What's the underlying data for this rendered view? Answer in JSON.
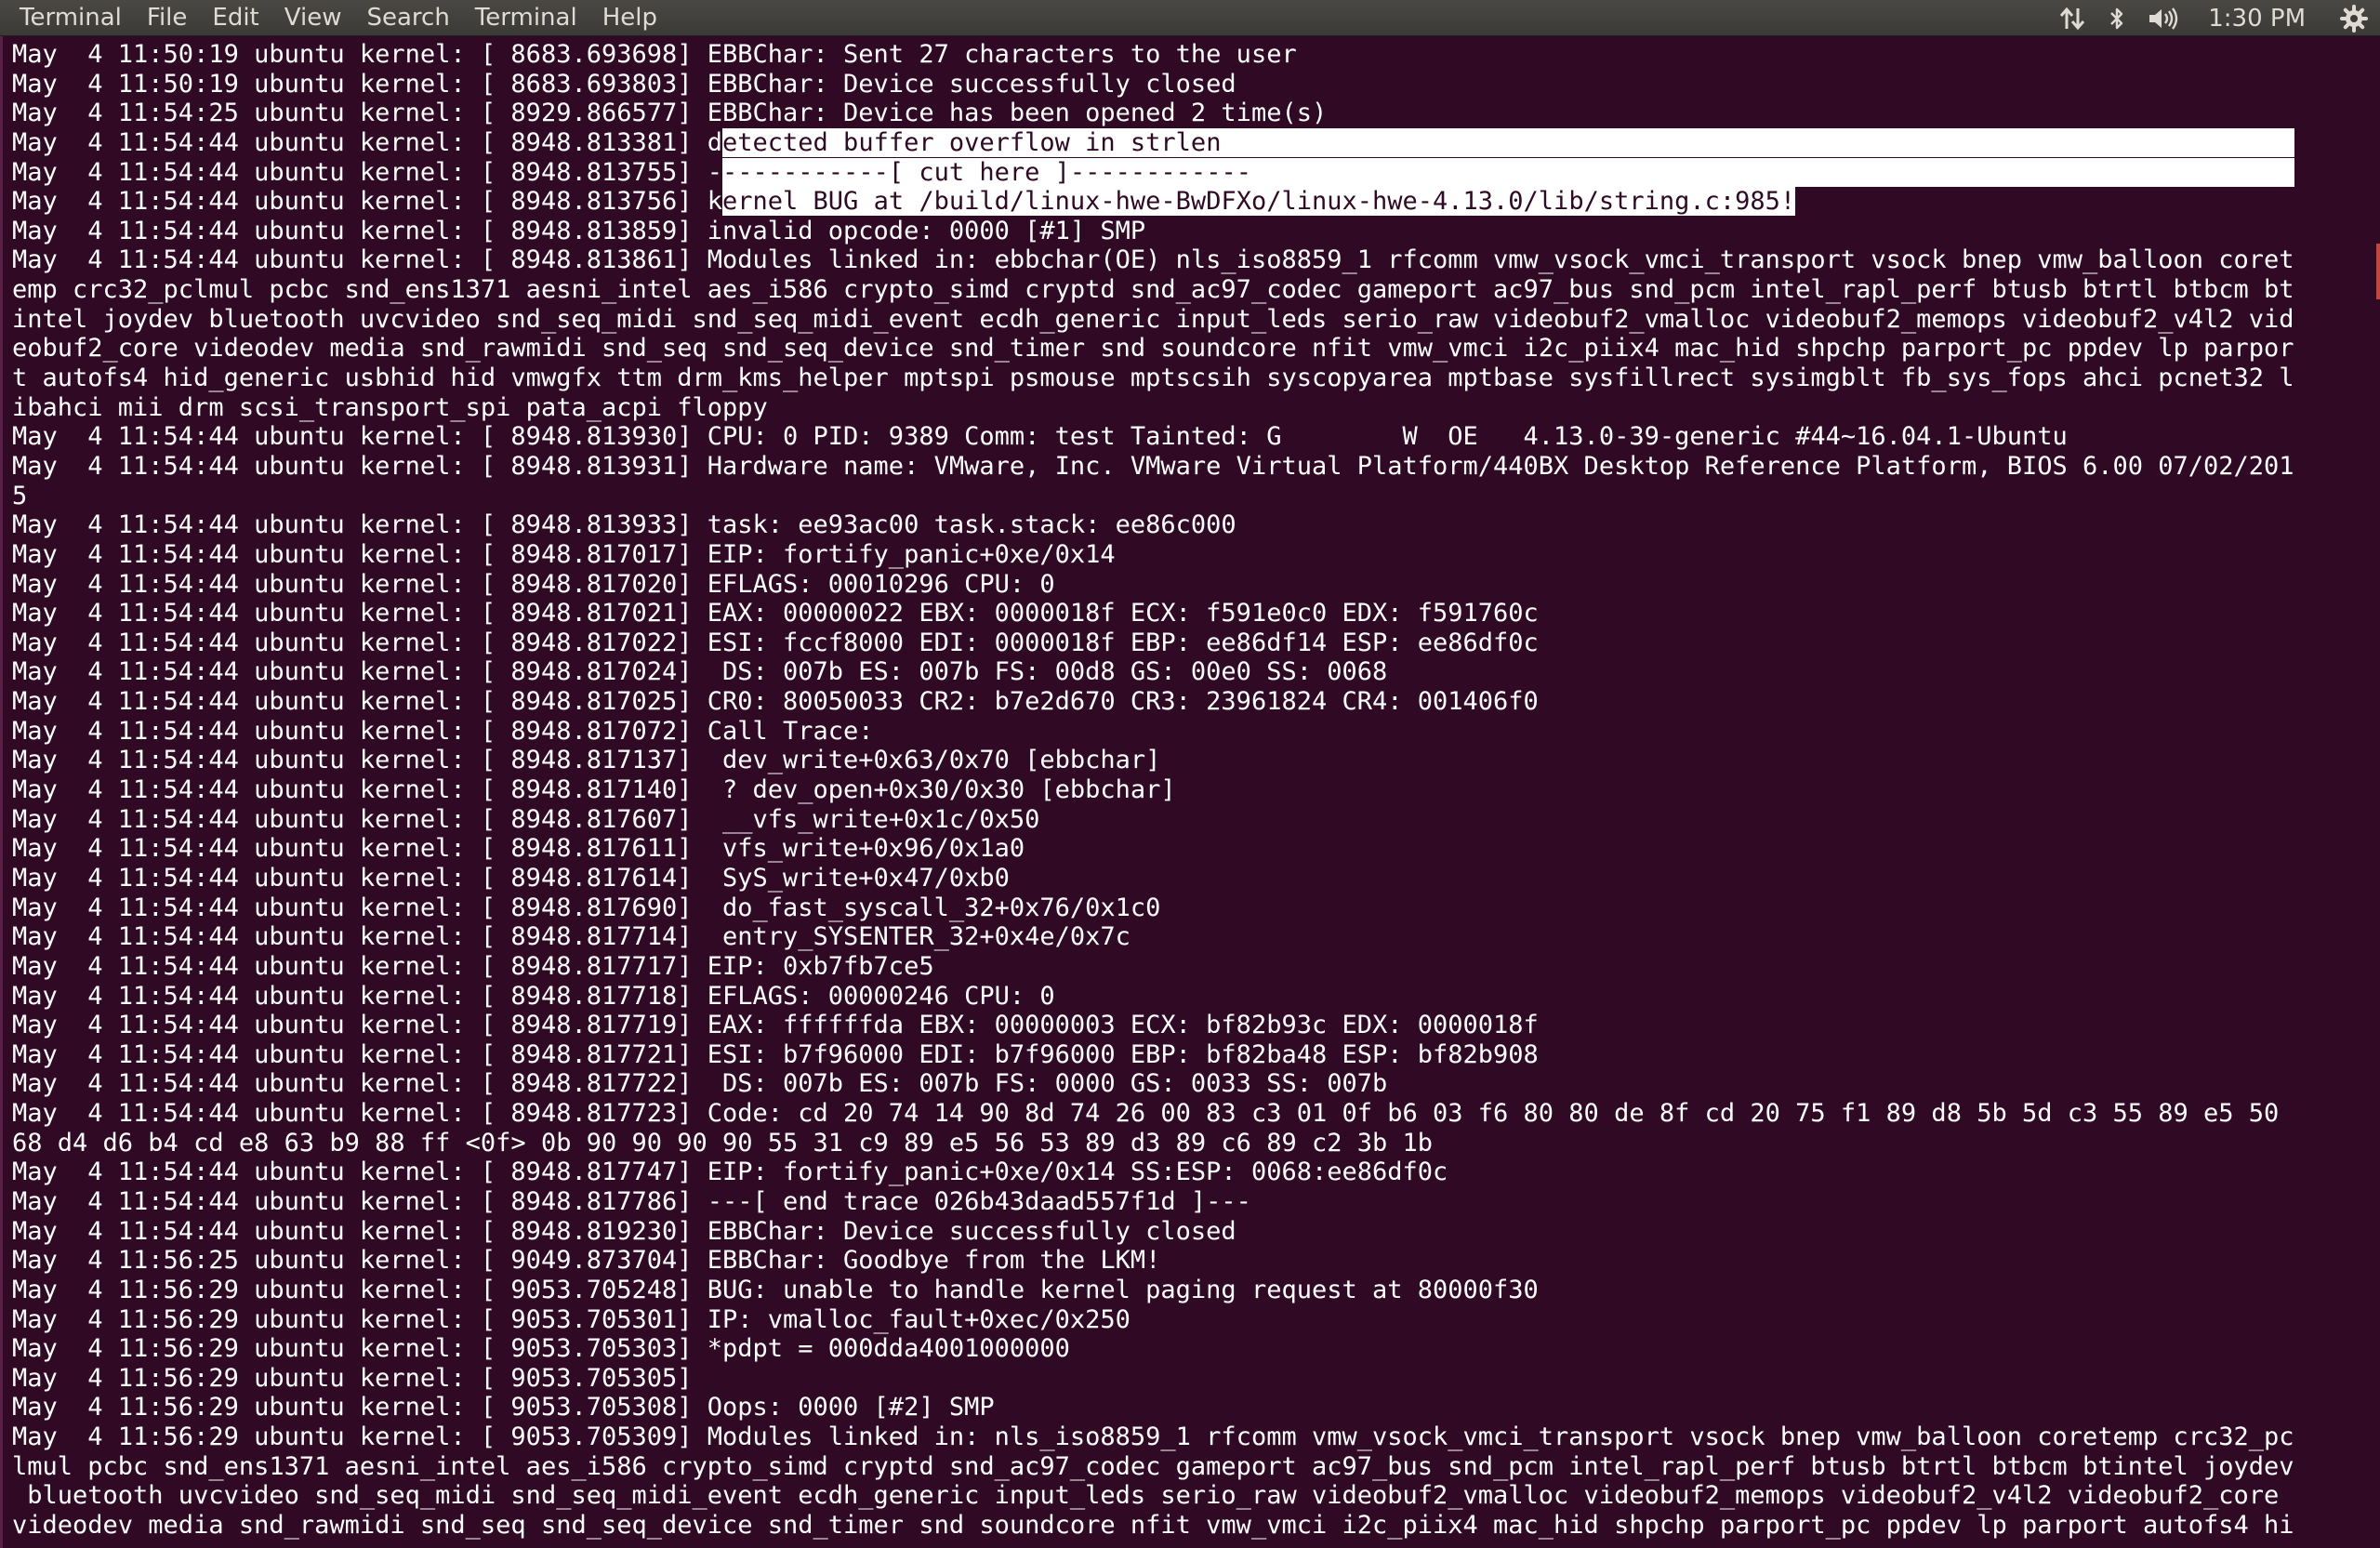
{
  "menubar": {
    "items": [
      "Terminal",
      "File",
      "Edit",
      "View",
      "Search",
      "Terminal",
      "Help"
    ],
    "indicators": {
      "network_icon": "network-updown-icon",
      "bluetooth_icon": "bluetooth-icon",
      "sound_icon": "volume-icon",
      "clock": "1:30 PM",
      "settings_icon": "gear-icon"
    }
  },
  "colors": {
    "terminal_bg": "#300a24",
    "terminal_fg": "#ffffff",
    "menubar_bg": "#3c3b37",
    "menubar_fg": "#dfdbd2",
    "selection_bg": "#ffffff"
  },
  "terminal": {
    "lines": [
      "May  4 11:50:19 ubuntu kernel: [ 8683.693698] EBBChar: Sent 27 characters to the user",
      "May  4 11:50:19 ubuntu kernel: [ 8683.693803] EBBChar: Device successfully closed",
      "May  4 11:54:25 ubuntu kernel: [ 8929.866577] EBBChar: Device has been opened 2 time(s)",
      "May  4 11:54:44 ubuntu kernel: [ 8948.813381] detected buffer overflow in strlen",
      "May  4 11:54:44 ubuntu kernel: [ 8948.813755] ------------[ cut here ]------------",
      "May  4 11:54:44 ubuntu kernel: [ 8948.813756] kernel BUG at /build/linux-hwe-BwDFXo/linux-hwe-4.13.0/lib/string.c:985!",
      "May  4 11:54:44 ubuntu kernel: [ 8948.813859] invalid opcode: 0000 [#1] SMP",
      "May  4 11:54:44 ubuntu kernel: [ 8948.813861] Modules linked in: ebbchar(OE) nls_iso8859_1 rfcomm vmw_vsock_vmci_transport vsock bnep vmw_balloon coret",
      "emp crc32_pclmul pcbc snd_ens1371 aesni_intel aes_i586 crypto_simd cryptd snd_ac97_codec gameport ac97_bus snd_pcm intel_rapl_perf btusb btrtl btbcm bt",
      "intel joydev bluetooth uvcvideo snd_seq_midi snd_seq_midi_event ecdh_generic input_leds serio_raw videobuf2_vmalloc videobuf2_memops videobuf2_v4l2 vid",
      "eobuf2_core videodev media snd_rawmidi snd_seq snd_seq_device snd_timer snd soundcore nfit vmw_vmci i2c_piix4 mac_hid shpchp parport_pc ppdev lp parpor",
      "t autofs4 hid_generic usbhid hid vmwgfx ttm drm_kms_helper mptspi psmouse mptscsih syscopyarea mptbase sysfillrect sysimgblt fb_sys_fops ahci pcnet32 l",
      "ibahci mii drm scsi_transport_spi pata_acpi floppy",
      "May  4 11:54:44 ubuntu kernel: [ 8948.813930] CPU: 0 PID: 9389 Comm: test Tainted: G        W  OE   4.13.0-39-generic #44~16.04.1-Ubuntu",
      "May  4 11:54:44 ubuntu kernel: [ 8948.813931] Hardware name: VMware, Inc. VMware Virtual Platform/440BX Desktop Reference Platform, BIOS 6.00 07/02/201",
      "5",
      "May  4 11:54:44 ubuntu kernel: [ 8948.813933] task: ee93ac00 task.stack: ee86c000",
      "May  4 11:54:44 ubuntu kernel: [ 8948.817017] EIP: fortify_panic+0xe/0x14",
      "May  4 11:54:44 ubuntu kernel: [ 8948.817020] EFLAGS: 00010296 CPU: 0",
      "May  4 11:54:44 ubuntu kernel: [ 8948.817021] EAX: 00000022 EBX: 0000018f ECX: f591e0c0 EDX: f591760c",
      "May  4 11:54:44 ubuntu kernel: [ 8948.817022] ESI: fccf8000 EDI: 0000018f EBP: ee86df14 ESP: ee86df0c",
      "May  4 11:54:44 ubuntu kernel: [ 8948.817024]  DS: 007b ES: 007b FS: 00d8 GS: 00e0 SS: 0068",
      "May  4 11:54:44 ubuntu kernel: [ 8948.817025] CR0: 80050033 CR2: b7e2d670 CR3: 23961824 CR4: 001406f0",
      "May  4 11:54:44 ubuntu kernel: [ 8948.817072] Call Trace:",
      "May  4 11:54:44 ubuntu kernel: [ 8948.817137]  dev_write+0x63/0x70 [ebbchar]",
      "May  4 11:54:44 ubuntu kernel: [ 8948.817140]  ? dev_open+0x30/0x30 [ebbchar]",
      "May  4 11:54:44 ubuntu kernel: [ 8948.817607]  __vfs_write+0x1c/0x50",
      "May  4 11:54:44 ubuntu kernel: [ 8948.817611]  vfs_write+0x96/0x1a0",
      "May  4 11:54:44 ubuntu kernel: [ 8948.817614]  SyS_write+0x47/0xb0",
      "May  4 11:54:44 ubuntu kernel: [ 8948.817690]  do_fast_syscall_32+0x76/0x1c0",
      "May  4 11:54:44 ubuntu kernel: [ 8948.817714]  entry_SYSENTER_32+0x4e/0x7c",
      "May  4 11:54:44 ubuntu kernel: [ 8948.817717] EIP: 0xb7fb7ce5",
      "May  4 11:54:44 ubuntu kernel: [ 8948.817718] EFLAGS: 00000246 CPU: 0",
      "May  4 11:54:44 ubuntu kernel: [ 8948.817719] EAX: ffffffda EBX: 00000003 ECX: bf82b93c EDX: 0000018f",
      "May  4 11:54:44 ubuntu kernel: [ 8948.817721] ESI: b7f96000 EDI: b7f96000 EBP: bf82ba48 ESP: bf82b908",
      "May  4 11:54:44 ubuntu kernel: [ 8948.817722]  DS: 007b ES: 007b FS: 0000 GS: 0033 SS: 007b",
      "May  4 11:54:44 ubuntu kernel: [ 8948.817723] Code: cd 20 74 14 90 8d 74 26 00 83 c3 01 0f b6 03 f6 80 80 de 8f cd 20 75 f1 89 d8 5b 5d c3 55 89 e5 50",
      "68 d4 d6 b4 cd e8 63 b9 88 ff <0f> 0b 90 90 90 90 55 31 c9 89 e5 56 53 89 d3 89 c6 89 c2 3b 1b",
      "May  4 11:54:44 ubuntu kernel: [ 8948.817747] EIP: fortify_panic+0xe/0x14 SS:ESP: 0068:ee86df0c",
      "May  4 11:54:44 ubuntu kernel: [ 8948.817786] ---[ end trace 026b43daad557f1d ]---",
      "May  4 11:54:44 ubuntu kernel: [ 8948.819230] EBBChar: Device successfully closed",
      "May  4 11:56:25 ubuntu kernel: [ 9049.873704] EBBChar: Goodbye from the LKM!",
      "May  4 11:56:29 ubuntu kernel: [ 9053.705248] BUG: unable to handle kernel paging request at 80000f30",
      "May  4 11:56:29 ubuntu kernel: [ 9053.705301] IP: vmalloc_fault+0xec/0x250",
      "May  4 11:56:29 ubuntu kernel: [ 9053.705303] *pdpt = 000dda4001000000",
      "May  4 11:56:29 ubuntu kernel: [ 9053.705305]",
      "May  4 11:56:29 ubuntu kernel: [ 9053.705308] Oops: 0000 [#2] SMP",
      "May  4 11:56:29 ubuntu kernel: [ 9053.705309] Modules linked in: nls_iso8859_1 rfcomm vmw_vsock_vmci_transport vsock bnep vmw_balloon coretemp crc32_pc",
      "lmul pcbc snd_ens1371 aesni_intel aes_i586 crypto_simd cryptd snd_ac97_codec gameport ac97_bus snd_pcm intel_rapl_perf btusb btrtl btbcm btintel joydev",
      " bluetooth uvcvideo snd_seq_midi snd_seq_midi_event ecdh_generic input_leds serio_raw videobuf2_vmalloc videobuf2_memops videobuf2_v4l2 videobuf2_core",
      "videodev media snd_rawmidi snd_seq snd_seq_device snd_timer snd soundcore nfit vmw_vmci i2c_piix4 mac_hid shpchp parport_pc ppdev lp parport autofs4 hi"
    ],
    "selection": {
      "lines": [
        3,
        4,
        5
      ],
      "prefix_chars": 47
    }
  }
}
